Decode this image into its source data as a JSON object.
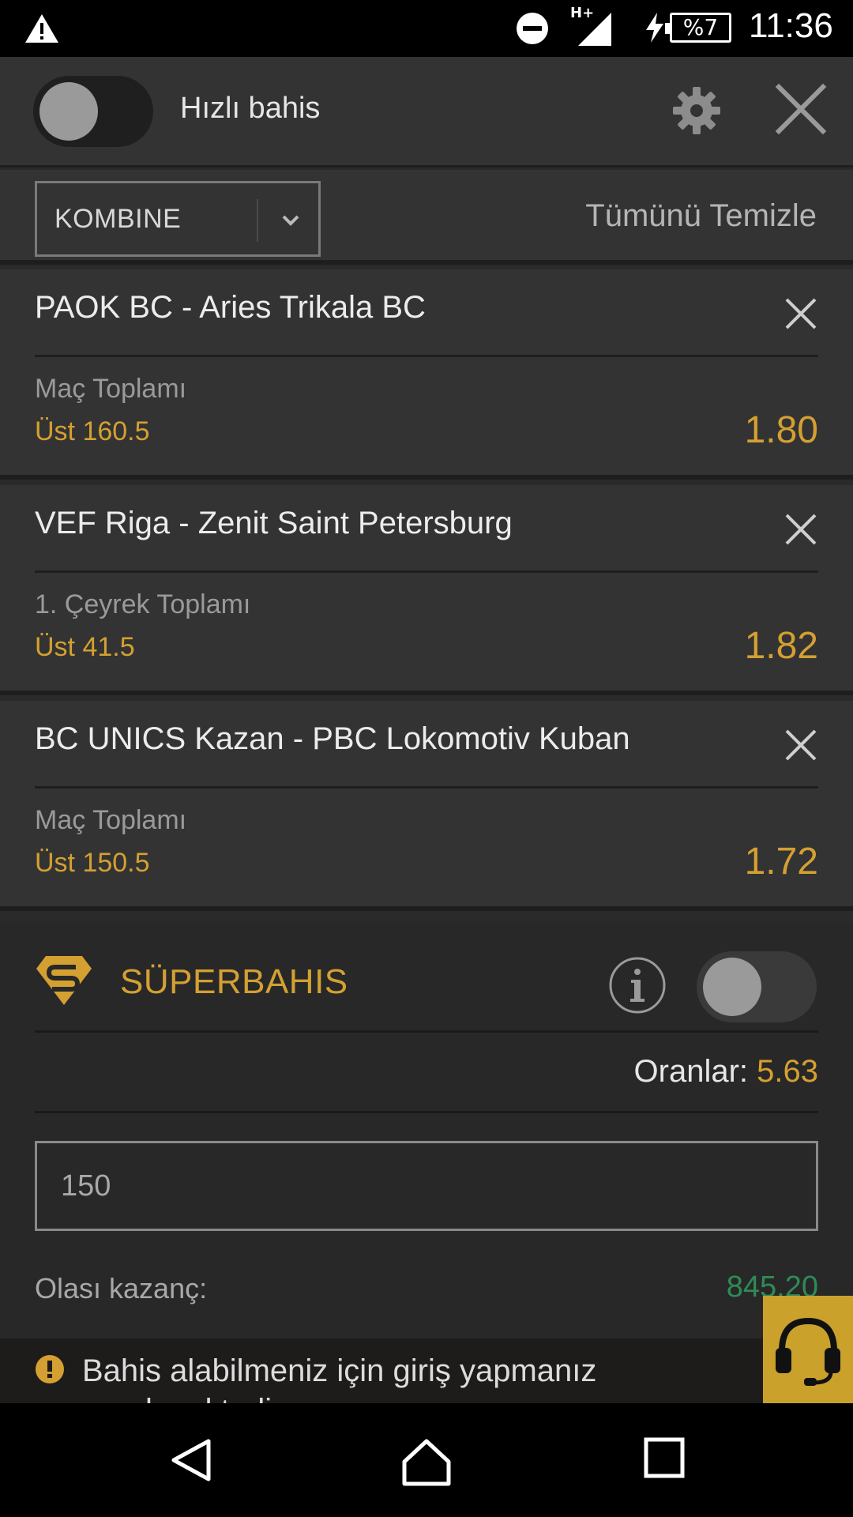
{
  "status_bar": {
    "time": "11:36",
    "battery": "%7",
    "network": "H+",
    "icons": [
      "warning-icon",
      "do-not-disturb-icon",
      "signal-icon",
      "charging-icon",
      "battery-icon"
    ]
  },
  "header": {
    "quick_bet_label": "Hızlı bahis",
    "quick_bet_on": false
  },
  "toolbar": {
    "bet_type": "KOMBINE",
    "clear_all": "Tümünü Temizle"
  },
  "bets": [
    {
      "match": "PAOK BC - Aries Trikala BC",
      "market": "Maç Toplamı",
      "selection": "Üst 160.5",
      "odds": "1.80"
    },
    {
      "match": "VEF Riga - Zenit Saint Petersburg",
      "market": "1. Çeyrek Toplamı",
      "selection": "Üst 41.5",
      "odds": "1.82"
    },
    {
      "match": "BC UNICS Kazan - PBC Lokomotiv Kuban",
      "market": "Maç Toplamı",
      "selection": "Üst 150.5",
      "odds": "1.72"
    }
  ],
  "superbet": {
    "title": "SÜPERBAHIS",
    "enabled": false,
    "odds_label": "Oranlar:",
    "odds_value": "5.63",
    "stake": "150",
    "win_label": "Olası kazanç:",
    "win_value": "845.20"
  },
  "notice": {
    "text": "Bahis alabilmeniz için giriş yapmanız gerekmektedir."
  },
  "colors": {
    "accent": "#d4a031",
    "win": "#2e8b57",
    "panel": "#333333",
    "background": "#282828"
  }
}
